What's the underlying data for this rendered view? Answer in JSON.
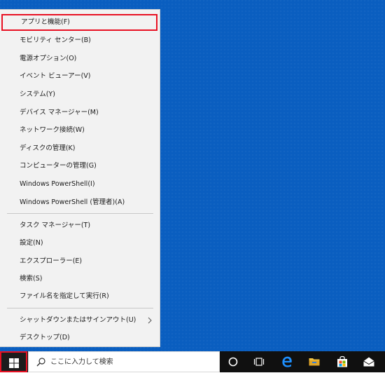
{
  "menu": {
    "items": [
      {
        "label": "アプリと機能(F)"
      },
      {
        "label": "モビリティ センター(B)"
      },
      {
        "label": "電源オプション(O)"
      },
      {
        "label": "イベント ビューアー(V)"
      },
      {
        "label": "システム(Y)"
      },
      {
        "label": "デバイス マネージャー(M)"
      },
      {
        "label": "ネットワーク接続(W)"
      },
      {
        "label": "ディスクの管理(K)"
      },
      {
        "label": "コンピューターの管理(G)"
      },
      {
        "label": "Windows PowerShell(I)"
      },
      {
        "label": "Windows PowerShell (管理者)(A)"
      },
      {
        "label": "タスク マネージャー(T)"
      },
      {
        "label": "設定(N)"
      },
      {
        "label": "エクスプローラー(E)"
      },
      {
        "label": "検索(S)"
      },
      {
        "label": "ファイル名を指定して実行(R)"
      },
      {
        "label": "シャットダウンまたはサインアウト(U)"
      },
      {
        "label": "デスクトップ(D)"
      }
    ]
  },
  "taskbar": {
    "search_placeholder": "ここに入力して検索",
    "icons": [
      "windows-logo-icon",
      "search-icon",
      "cortana-icon",
      "task-view-icon",
      "edge-icon",
      "file-explorer-icon",
      "store-icon",
      "mail-icon"
    ]
  },
  "colors": {
    "desktop": "#0a5ec0",
    "highlight_border": "#e81123",
    "taskbar": "#101010",
    "menu_bg": "#f2f2f2"
  }
}
